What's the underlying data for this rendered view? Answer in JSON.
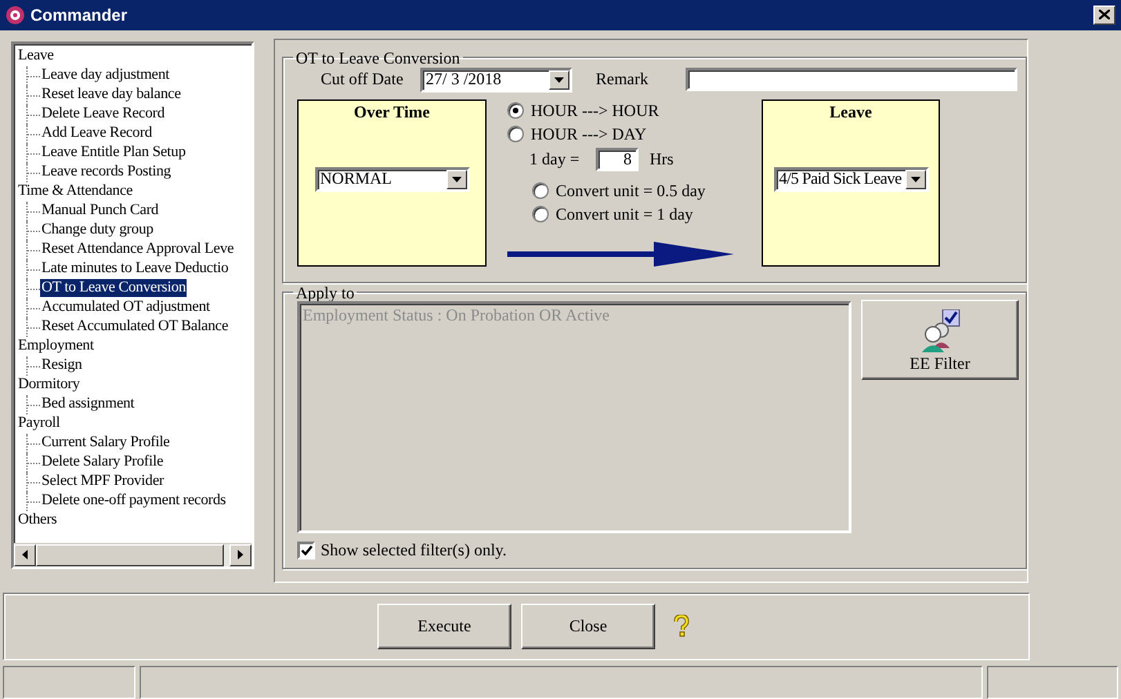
{
  "window": {
    "title": "Commander"
  },
  "tree": [
    {
      "label": "Leave",
      "selected": false,
      "children": [
        {
          "label": "Leave day adjustment",
          "selected": false
        },
        {
          "label": "Reset leave day balance",
          "selected": false
        },
        {
          "label": "Delete Leave Record",
          "selected": false
        },
        {
          "label": "Add Leave Record",
          "selected": false
        },
        {
          "label": "Leave Entitle Plan Setup",
          "selected": false
        },
        {
          "label": "Leave records Posting",
          "selected": false
        }
      ]
    },
    {
      "label": "Time & Attendance",
      "selected": false,
      "children": [
        {
          "label": "Manual Punch Card",
          "selected": false
        },
        {
          "label": "Change duty group",
          "selected": false
        },
        {
          "label": "Reset Attendance Approval Leve",
          "selected": false
        },
        {
          "label": "Late minutes to Leave Deductio",
          "selected": false
        },
        {
          "label": "OT to Leave Conversion",
          "selected": true
        },
        {
          "label": "Accumulated OT adjustment",
          "selected": false
        },
        {
          "label": "Reset Accumulated OT Balance",
          "selected": false
        }
      ]
    },
    {
      "label": "Employment",
      "selected": false,
      "children": [
        {
          "label": "Resign",
          "selected": false
        }
      ]
    },
    {
      "label": "Dormitory",
      "selected": false,
      "children": [
        {
          "label": "Bed assignment",
          "selected": false
        }
      ]
    },
    {
      "label": "Payroll",
      "selected": false,
      "children": [
        {
          "label": "Current Salary Profile",
          "selected": false
        },
        {
          "label": "Delete Salary Profile",
          "selected": false
        },
        {
          "label": "Select MPF Provider",
          "selected": false
        },
        {
          "label": "Delete one-off payment records",
          "selected": false
        }
      ]
    },
    {
      "label": "Others",
      "selected": false
    }
  ],
  "conversion": {
    "title": "OT to Leave Conversion",
    "cut_off_label": "Cut off Date",
    "cut_off_date": "27/ 3 /2018",
    "remark_label": "Remark",
    "overtime": {
      "title": "Over Time",
      "value": "NORMAL"
    },
    "modes": [
      {
        "label": "HOUR ---> HOUR",
        "selected": true
      },
      {
        "label": "HOUR ---> DAY",
        "selected": false
      }
    ],
    "day_label": "1 day =",
    "day_hours": "8",
    "day_unit": "Hrs",
    "units": [
      {
        "label": "Convert unit = 0.5 day",
        "selected": false
      },
      {
        "label": "Convert unit = 1 day",
        "selected": false
      }
    ],
    "leave": {
      "title": "Leave",
      "value": "4/5 Paid Sick Leave"
    }
  },
  "apply_to": {
    "title": "Apply to",
    "filters": [
      "Employment Status : On Probation OR Active"
    ],
    "filter_button": "EE Filter",
    "show_selected": {
      "label": "Show selected filter(s) only.",
      "checked": true
    }
  },
  "buttons": [
    "Execute",
    "Close"
  ]
}
